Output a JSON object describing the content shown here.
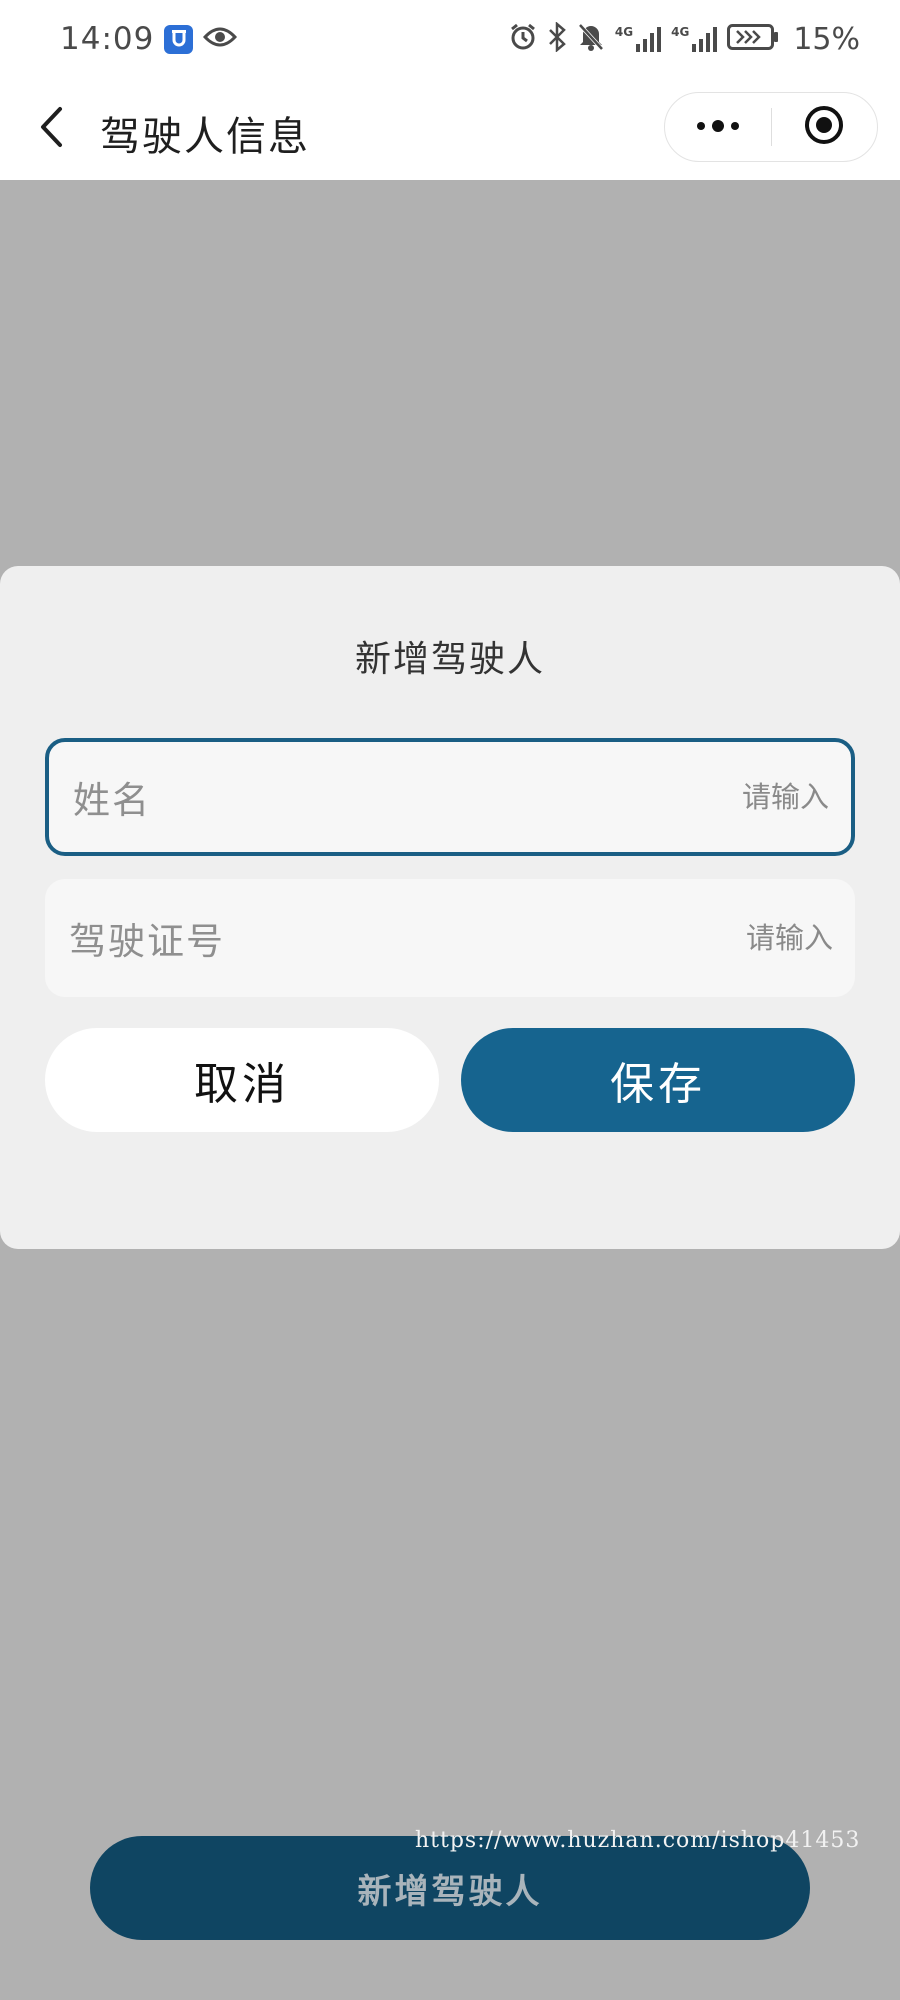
{
  "status_bar": {
    "time": "14:09",
    "battery_percent": "15%",
    "network_labels": [
      "4G",
      "4G"
    ],
    "icons": [
      "app-badge-icon",
      "eye-icon",
      "alarm-icon",
      "bluetooth-icon",
      "mute-icon",
      "signal-icon",
      "signal-icon",
      "battery-icon"
    ]
  },
  "nav": {
    "title": "驾驶人信息",
    "icons": [
      "back-arrow-icon",
      "more-dots-icon",
      "target-close-icon"
    ]
  },
  "dialog": {
    "title": "新增驾驶人",
    "fields": [
      {
        "label": "姓名",
        "placeholder": "请输入",
        "value": ""
      },
      {
        "label": "驾驶证号",
        "placeholder": "请输入",
        "value": ""
      }
    ],
    "cancel_label": "取消",
    "save_label": "保存"
  },
  "page": {
    "add_button_label": "新增驾驶人",
    "watermark": "https://www.huzhan.com/ishop41453"
  },
  "colors": {
    "primary": "#16648f",
    "overlay": "#b1b1b1",
    "dialog_bg": "#efefef",
    "focus_border": "#1a5e84"
  }
}
